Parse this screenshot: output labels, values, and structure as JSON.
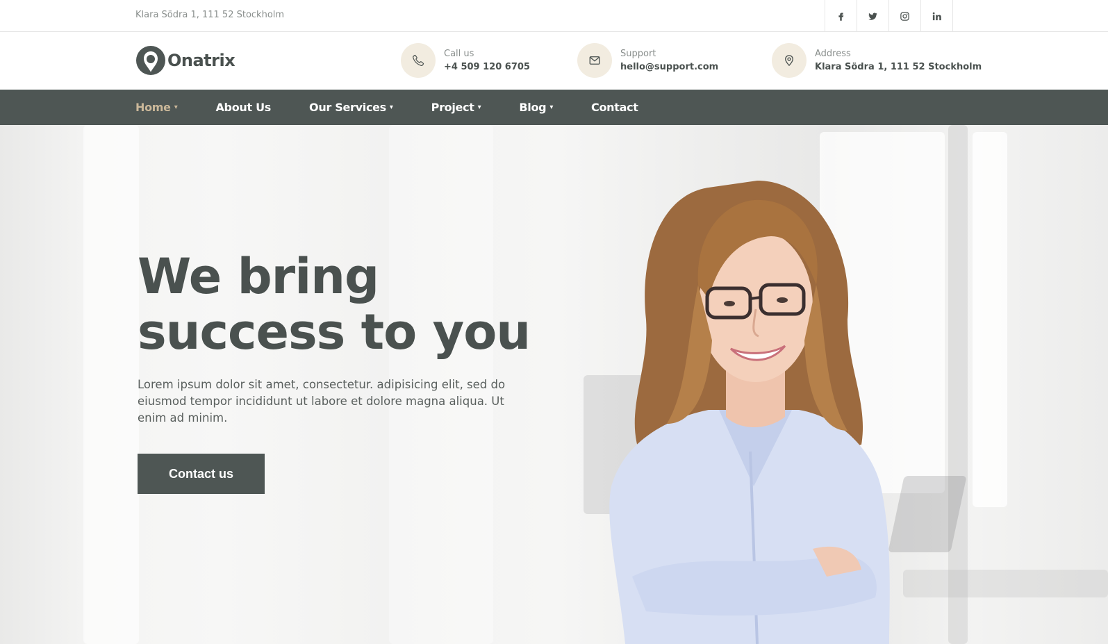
{
  "topbar": {
    "address": "Klara Södra 1, 111 52 Stockholm",
    "socials": [
      {
        "icon": "facebook-icon",
        "glyph": "f"
      },
      {
        "icon": "twitter-icon",
        "glyph": "t"
      },
      {
        "icon": "instagram-icon",
        "glyph": "ig"
      },
      {
        "icon": "linkedin-icon",
        "glyph": "in"
      }
    ]
  },
  "header": {
    "logo_text": "Onatrix",
    "contacts": [
      {
        "icon": "phone-icon",
        "label": "Call us",
        "value": "+4 509 120 6705"
      },
      {
        "icon": "mail-icon",
        "label": "Support",
        "value": "hello@support.com"
      },
      {
        "icon": "location-pin-icon",
        "label": "Address",
        "value": "Klara Södra 1, 111 52 Stockholm"
      }
    ]
  },
  "nav": {
    "items": [
      {
        "label": "Home",
        "has_dropdown": true,
        "active": true
      },
      {
        "label": "About Us",
        "has_dropdown": false,
        "active": false
      },
      {
        "label": "Our Services",
        "has_dropdown": true,
        "active": false
      },
      {
        "label": "Project",
        "has_dropdown": true,
        "active": false
      },
      {
        "label": "Blog",
        "has_dropdown": true,
        "active": false
      },
      {
        "label": "Contact",
        "has_dropdown": false,
        "active": false
      }
    ]
  },
  "hero": {
    "title_line1": "We bring",
    "title_line2": "success to you",
    "text": "Lorem ipsum dolor sit amet, consectetur. adipisicing elit, sed do eiusmod tempor incididunt ut labore et dolore magna aliqua. Ut enim ad minim.",
    "cta_label": "Contact us"
  },
  "colors": {
    "primary": "#4e5654",
    "accent": "#cbb89a",
    "icon_bg": "#f2ece0",
    "text_muted": "#8a8f8d"
  }
}
